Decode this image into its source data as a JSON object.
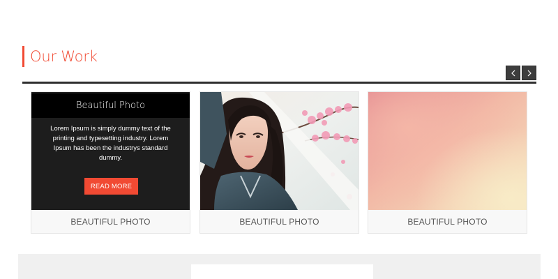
{
  "section": {
    "title": "Our Work"
  },
  "carousel": {
    "prev_icon": "chevron-left-icon",
    "next_icon": "chevron-right-icon",
    "cards": [
      {
        "caption": "BEAUTIFUL PHOTO",
        "overlay": {
          "title": "Beautiful Photo",
          "text": "Lorem Ipsum is simply dummy text of the printing and typesetting industry. Lorem Ipsum has been the industrys standard dummy.",
          "button_label": "READ MORE"
        }
      },
      {
        "caption": "BEAUTIFUL PHOTO"
      },
      {
        "caption": "BEAUTIFUL PHOTO"
      }
    ]
  },
  "colors": {
    "accent": "#f14a33",
    "dark": "#1d1d1d"
  }
}
